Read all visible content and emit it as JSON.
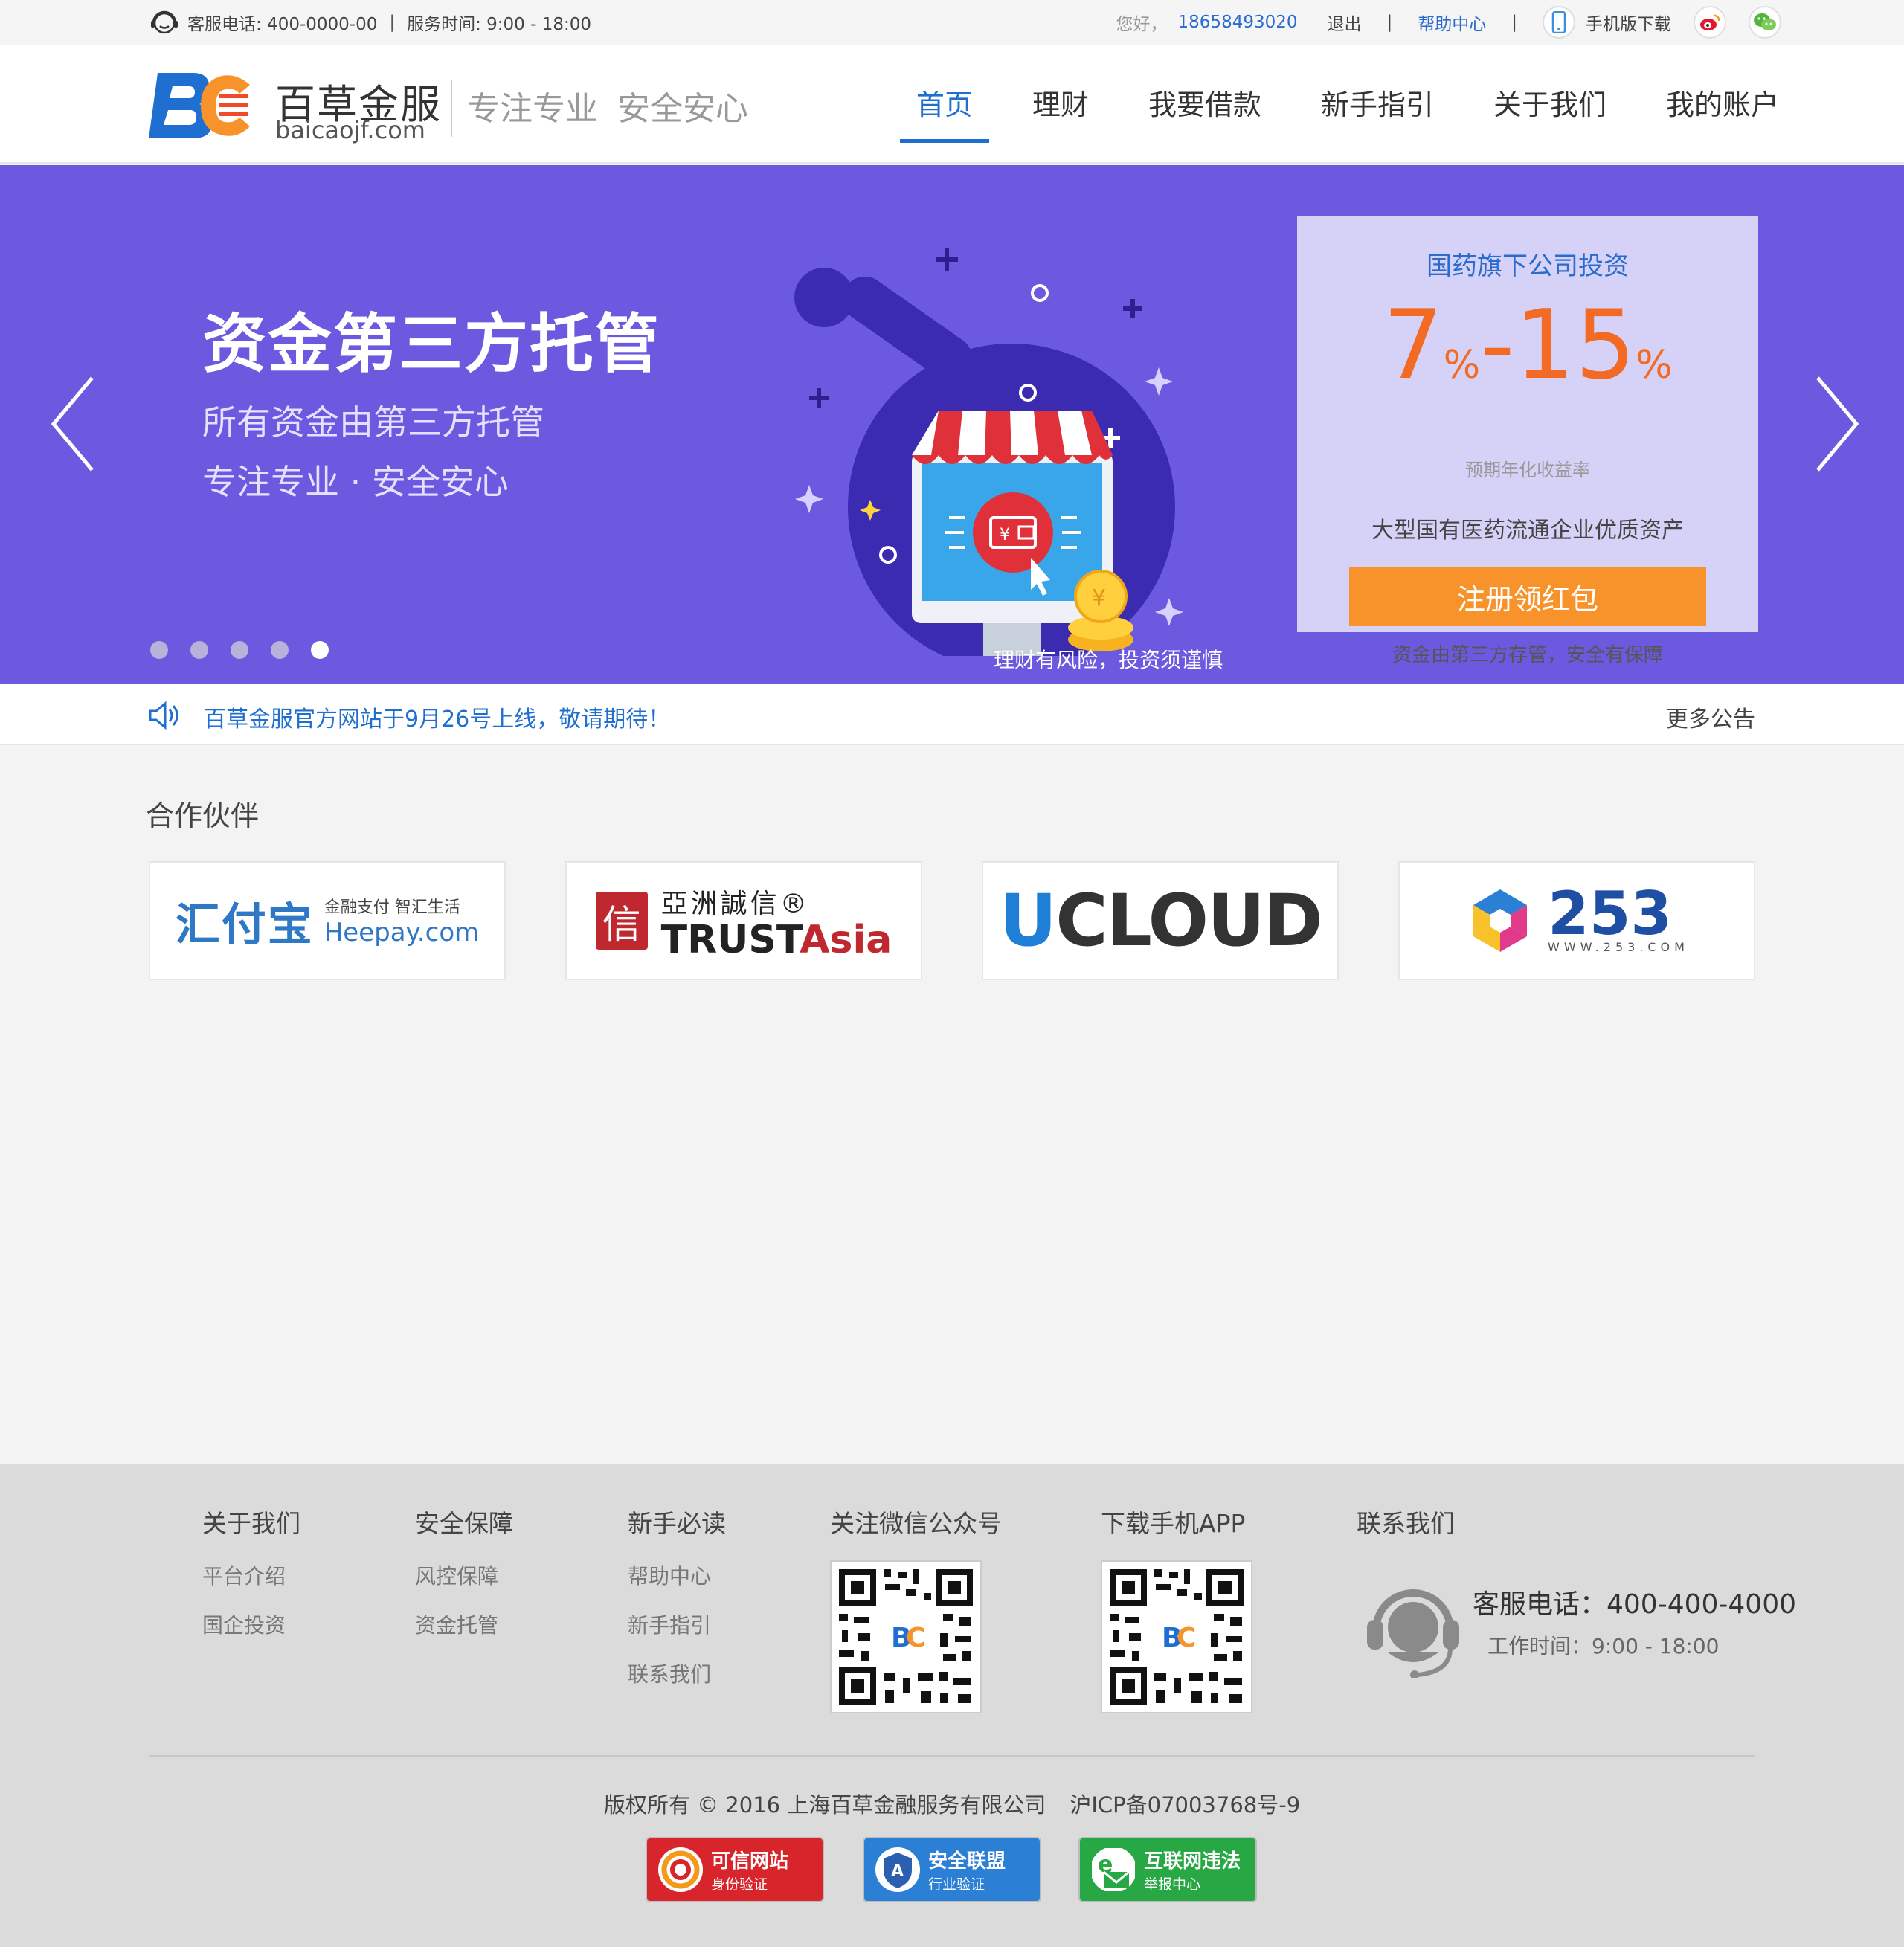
{
  "topbar": {
    "service_phone": "客服电话: 400-0000-00",
    "separator": "|",
    "service_hours": "服务时间: 9:00 - 18:00",
    "greeting": "您好，",
    "user_phone": "18658493020",
    "logout": "退出",
    "divider": "|",
    "help_center": "帮助中心",
    "mobile_download": "手机版下载"
  },
  "header": {
    "brand_cn": "百草金服",
    "brand_en": "baicaojf.com",
    "slogan_1": "专注专业",
    "slogan_2": "安全安心",
    "nav": [
      {
        "label": "首页",
        "active": true
      },
      {
        "label": "理财"
      },
      {
        "label": "我要借款"
      },
      {
        "label": "新手指引"
      },
      {
        "label": "关于我们"
      },
      {
        "label": "我的账户"
      }
    ]
  },
  "banner": {
    "title": "资金第三方托管",
    "subtitle_1": "所有资金由第三方托管",
    "subtitle_2": "专注专业  ·  安全安心",
    "risk_note": "理财有风险，投资须谨慎",
    "active_slide": 5,
    "slide_count": 5,
    "card": {
      "title": "国药旗下公司投资",
      "rate_low": "7",
      "rate_high": "-15",
      "percent": "%",
      "rate_label": "预期年化收益率",
      "description": "大型国有医药流通企业优质资产",
      "button": "注册领红包",
      "note": "资金由第三方存管，安全有保障"
    }
  },
  "notice": {
    "text": "百草金服官方网站于9月26号上线，敬请期待！",
    "more": "更多公告"
  },
  "partners": {
    "title": "合作伙伴",
    "heepay": {
      "cn": "汇付宝",
      "tagline": "金融支付 智汇生活",
      "en": "Heepay.com"
    },
    "trustasia": {
      "box": "信",
      "cn": "亞洲誠信®",
      "en_1": "TRUST",
      "en_2": "Asia"
    },
    "ucloud": {
      "u": "U",
      "rest": "CLOUD"
    },
    "n253": {
      "num": "253",
      "url": "WWW.253.COM"
    }
  },
  "footer": {
    "columns": [
      {
        "heading": "关于我们",
        "links": [
          "平台介绍",
          "国企投资"
        ]
      },
      {
        "heading": "安全保障",
        "links": [
          "风控保障",
          "资金托管"
        ]
      },
      {
        "heading": "新手必读",
        "links": [
          "帮助中心",
          "新手指引",
          "联系我们"
        ]
      }
    ],
    "wechat_heading": "关注微信公众号",
    "app_heading": "下载手机APP",
    "contact_heading": "联系我们",
    "contact_phone": "客服电话：400-400-4000",
    "contact_hours": "工作时间：9:00 - 18:00",
    "copyright": "版权所有 © 2016 上海百草金融服务有限公司",
    "icp": "沪ICP备07003768号-9",
    "badges": [
      {
        "line1": "可信网站",
        "line2": "身份验证",
        "color": "#d8242b"
      },
      {
        "line1": "安全联盟",
        "line2": "行业验证",
        "color": "#2b7fd4"
      },
      {
        "line1": "互联网违法",
        "line2": "举报中心",
        "color": "#27a844"
      }
    ]
  },
  "colors": {
    "brand_blue": "#1f6fd1",
    "banner_purple": "#6b5ae0",
    "accent_orange": "#f7932a",
    "rate_orange": "#f36a24"
  }
}
